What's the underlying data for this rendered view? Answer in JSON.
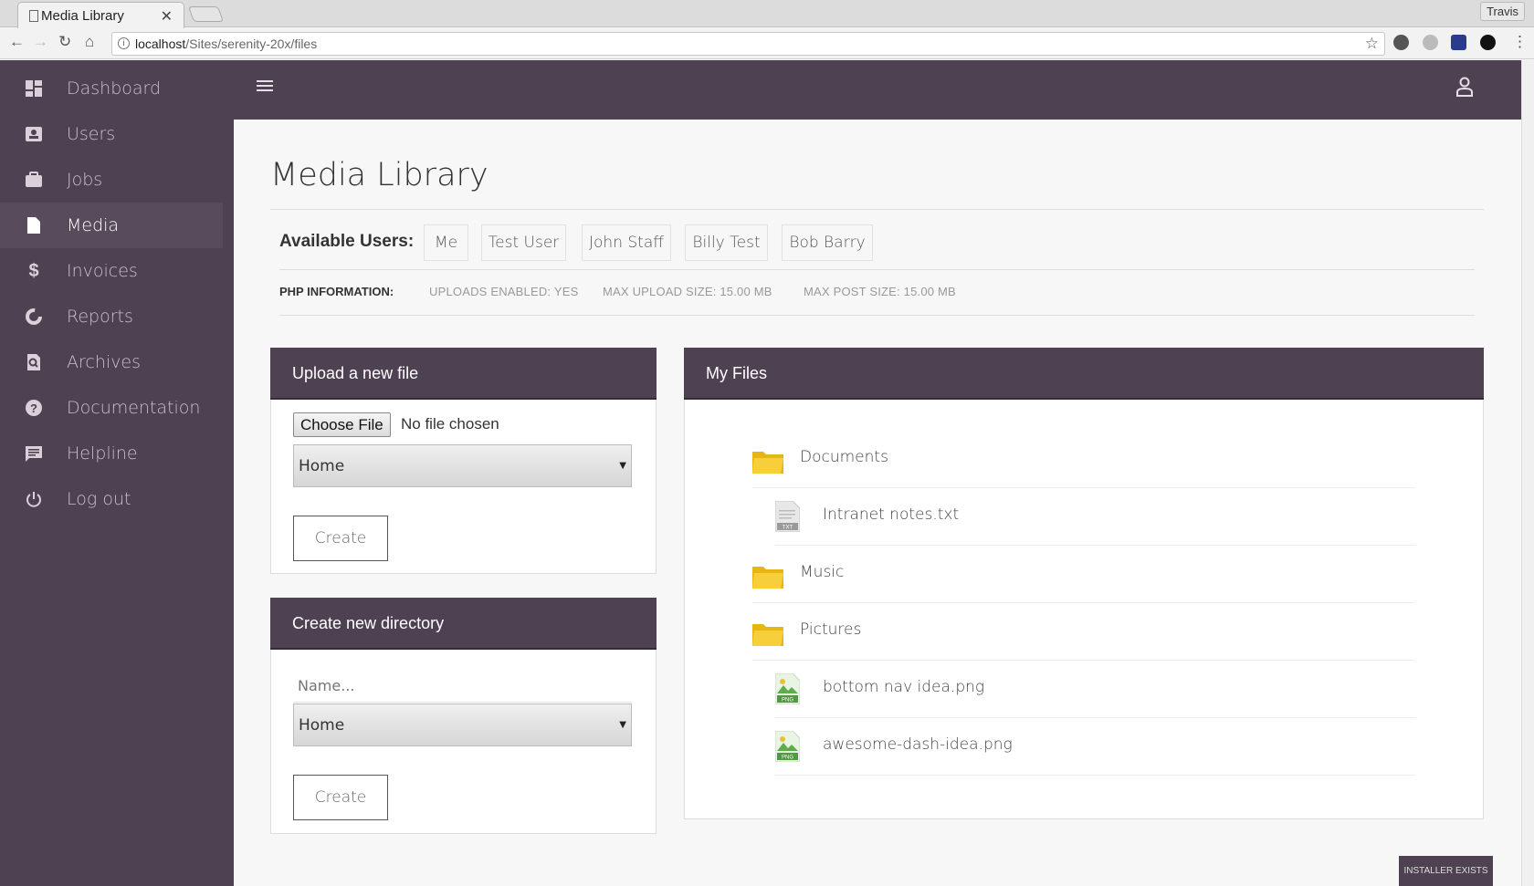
{
  "browser": {
    "tab_title": "Media Library",
    "url_host": "localhost",
    "url_path": "/Sites/serenity-20x/files",
    "profile": "Travis"
  },
  "sidebar": {
    "items": [
      {
        "label": "Dashboard",
        "icon": "dashboard-icon"
      },
      {
        "label": "Users",
        "icon": "users-icon"
      },
      {
        "label": "Jobs",
        "icon": "briefcase-icon"
      },
      {
        "label": "Media",
        "icon": "file-icon",
        "active": true
      },
      {
        "label": "Invoices",
        "icon": "dollar-icon"
      },
      {
        "label": "Reports",
        "icon": "reports-icon"
      },
      {
        "label": "Archives",
        "icon": "archive-icon"
      },
      {
        "label": "Documentation",
        "icon": "help-icon"
      },
      {
        "label": "Helpline",
        "icon": "chat-icon"
      },
      {
        "label": "Log out",
        "icon": "power-icon"
      }
    ]
  },
  "page": {
    "title": "Media Library",
    "available_users_label": "Available Users:",
    "users": [
      "Me",
      "Test User",
      "John Staff",
      "Billy Test",
      "Bob Barry"
    ],
    "php_label": "PHP INFORMATION:",
    "php_stats": [
      "UPLOADS ENABLED: YES",
      "MAX UPLOAD SIZE: 15.00 MB",
      "MAX POST SIZE: 15.00 MB"
    ]
  },
  "upload": {
    "title": "Upload a new file",
    "choose_file": "Choose File",
    "no_file": "No file chosen",
    "directory": "Home",
    "create": "Create"
  },
  "new_dir": {
    "title": "Create new directory",
    "name_placeholder": "Name...",
    "directory": "Home",
    "create": "Create"
  },
  "files": {
    "title": "My Files",
    "items": [
      {
        "name": "Documents",
        "type": "folder"
      },
      {
        "name": "Intranet notes.txt",
        "type": "txt"
      },
      {
        "name": "Music",
        "type": "folder"
      },
      {
        "name": "Pictures",
        "type": "folder"
      },
      {
        "name": "bottom nav idea.png",
        "type": "png"
      },
      {
        "name": "awesome-dash-idea.png",
        "type": "png"
      }
    ]
  },
  "footer": {
    "installer": "INSTALLER EXISTS"
  },
  "colors": {
    "brand": "#4e4152",
    "folder": "#f0c419"
  }
}
